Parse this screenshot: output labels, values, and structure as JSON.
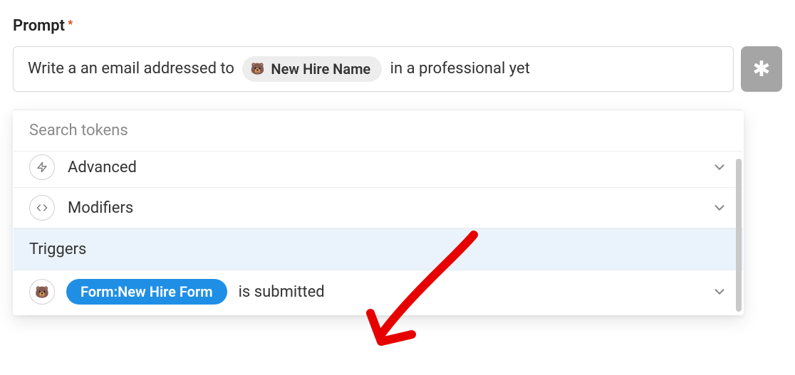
{
  "field": {
    "label": "Prompt",
    "required_mark": "*"
  },
  "editor": {
    "text_before": "Write a an email addressed to ",
    "token_label": "New Hire Name",
    "text_after": " in a professional yet"
  },
  "sidebar_button_glyph": "✱",
  "popover": {
    "search_placeholder": "Search tokens",
    "categories": [
      {
        "id": "advanced",
        "label": "Advanced",
        "icon": "bolt"
      },
      {
        "id": "modifiers",
        "label": "Modifiers",
        "icon": "code"
      }
    ],
    "section_header": "Triggers",
    "trigger": {
      "form_prefix": "Form: ",
      "form_name": "New Hire Form",
      "suffix_text": "is submitted"
    }
  }
}
